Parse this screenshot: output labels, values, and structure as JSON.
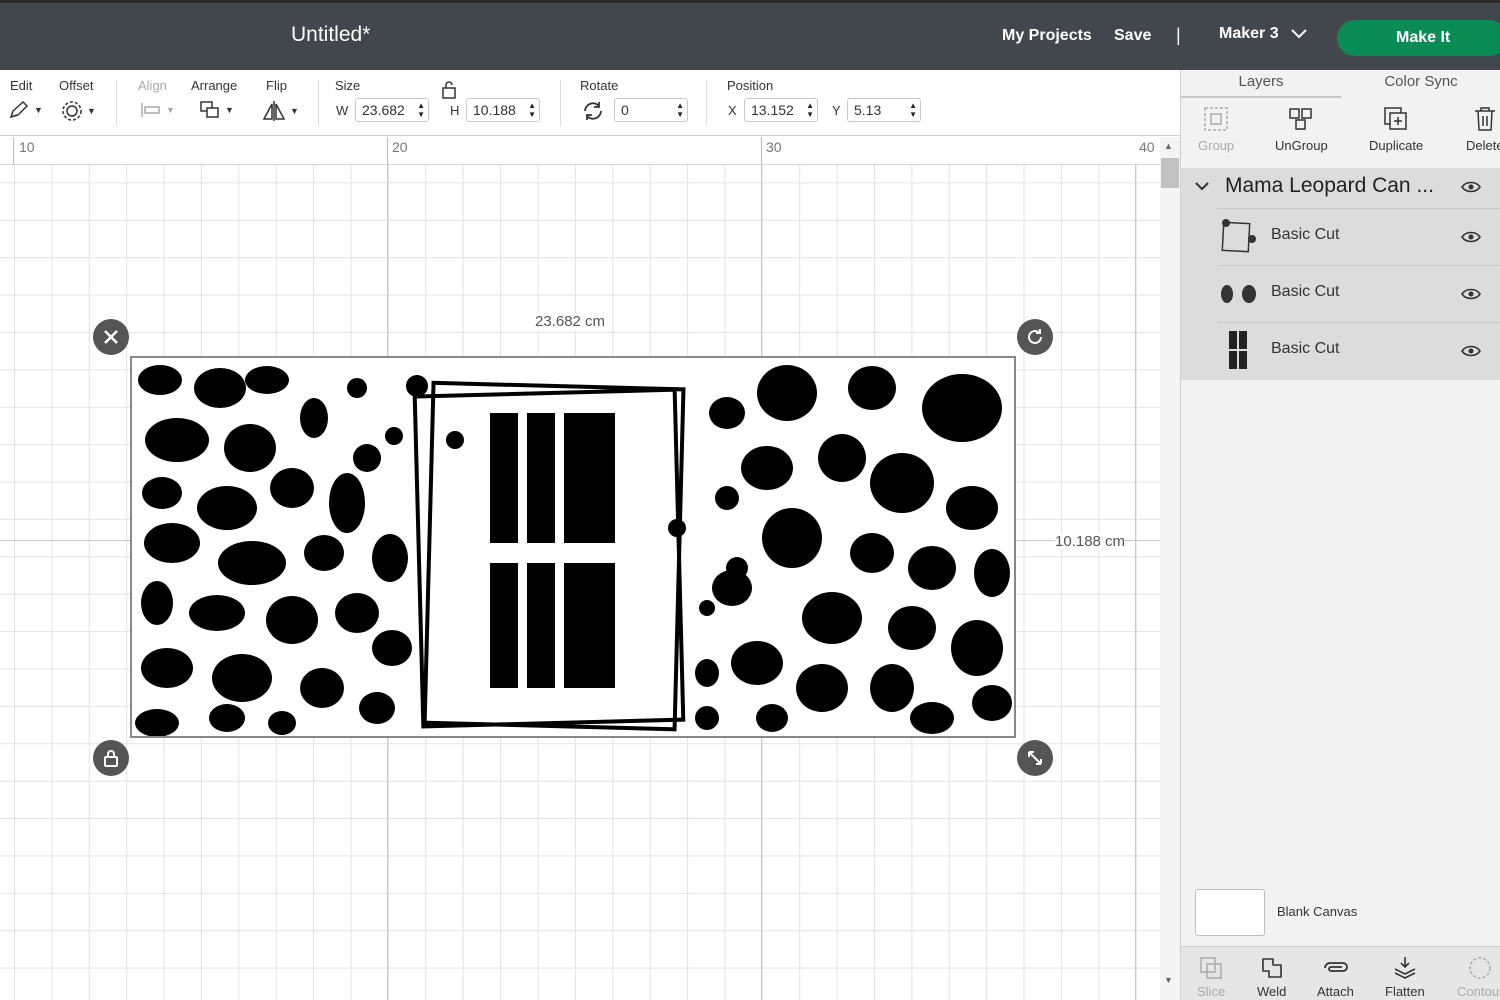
{
  "header": {
    "title": "Untitled*",
    "my_projects": "My Projects",
    "save": "Save",
    "separator": "|",
    "machine": "Maker 3",
    "make_it": "Make It"
  },
  "toolbar": {
    "edit": "Edit",
    "offset": "Offset",
    "align": "Align",
    "arrange": "Arrange",
    "flip": "Flip",
    "size": "Size",
    "w_label": "W",
    "w_value": "23.682",
    "h_label": "H",
    "h_value": "10.188",
    "rotate": "Rotate",
    "rotate_value": "0",
    "position": "Position",
    "x_label": "X",
    "x_value": "13.152",
    "y_label": "Y",
    "y_value": "5.13"
  },
  "canvas": {
    "ruler": [
      "10",
      "20",
      "30",
      "40"
    ],
    "width_label": "23.682 cm",
    "height_label": "10.188 cm"
  },
  "panel": {
    "tabs": [
      "Layers",
      "Color Sync"
    ],
    "actions": {
      "group": "Group",
      "ungroup": "UnGroup",
      "duplicate": "Duplicate",
      "delete": "Delete"
    },
    "group_name": "Mama Leopard Can ...",
    "layers": [
      {
        "name": "Basic Cut"
      },
      {
        "name": "Basic Cut"
      },
      {
        "name": "Basic Cut"
      }
    ],
    "blank_canvas": "Blank Canvas",
    "bottom_actions": {
      "slice": "Slice",
      "weld": "Weld",
      "attach": "Attach",
      "flatten": "Flatten",
      "contour": "Contour"
    }
  }
}
